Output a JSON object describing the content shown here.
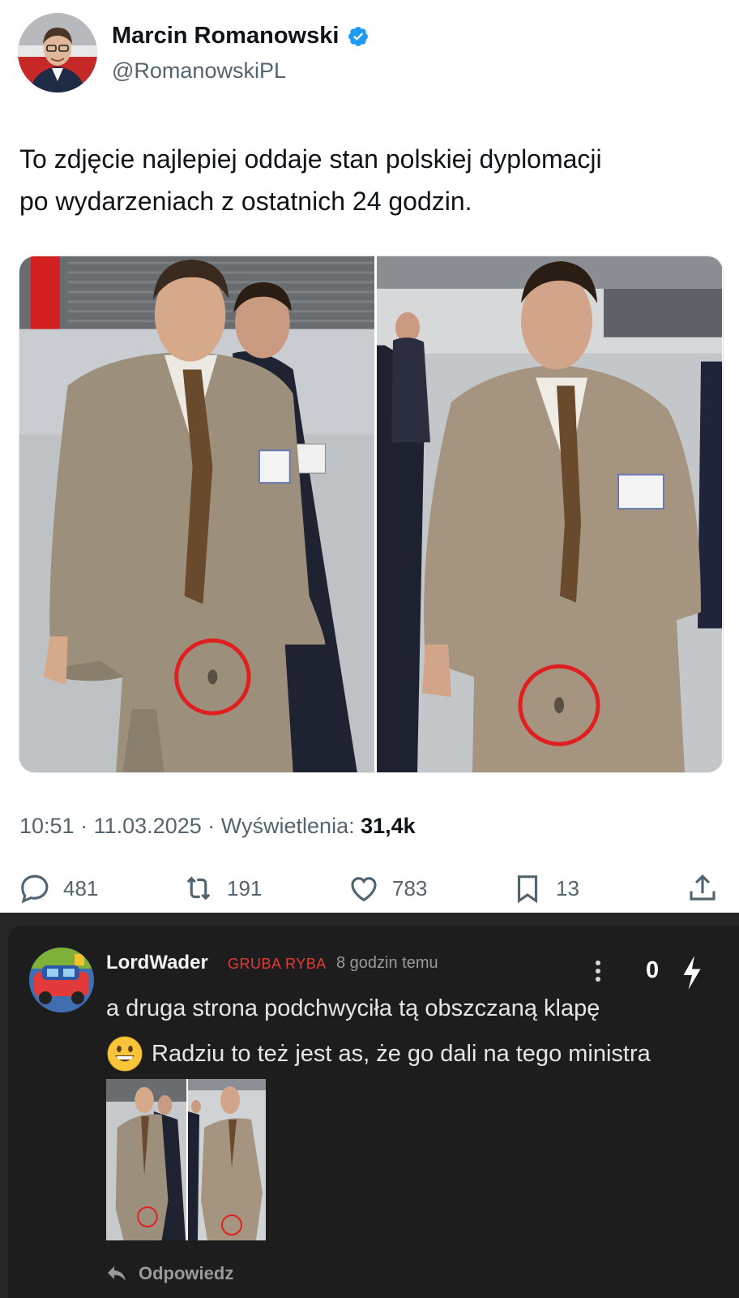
{
  "tweet": {
    "author_name": "Marcin Romanowski",
    "handle": "@RomanowskiPL",
    "text_line1": "To zdjęcie najlepiej oddaje stan polskiej dyplomacji",
    "text_line2": "po wydarzeniach z ostatnich 24 godzin.",
    "time": "10:51",
    "date": "11.03.2025",
    "views_label": "Wyświetlenia:",
    "views_count": "31,4k",
    "separator": "·",
    "actions": {
      "replies": "481",
      "reposts": "191",
      "likes": "783",
      "bookmarks": "13"
    },
    "icons": [
      "verified-badge-icon",
      "reply-icon",
      "repost-icon",
      "like-icon",
      "bookmark-icon",
      "share-icon"
    ]
  },
  "comment": {
    "username": "LordWader",
    "rank": "GRUBA RYBA",
    "time_ago": "8 godzin temu",
    "score": "0",
    "text_line1": "a druga strona podchwyciła tą obszczaną klapę",
    "text_line2": "Radziu to też jest as, że go dali na tego ministra",
    "reply_label": "Odpowiedz",
    "icons": [
      "more-vertical-icon",
      "bolt-icon",
      "grinning-emoji-icon",
      "reply-arrow-icon"
    ]
  },
  "colors": {
    "verified_blue": "#1d9bf0",
    "secondary_text": "#536471",
    "comment_bg": "#1d1d1d",
    "rank_red": "#e53935",
    "circle_red": "#e02020"
  }
}
